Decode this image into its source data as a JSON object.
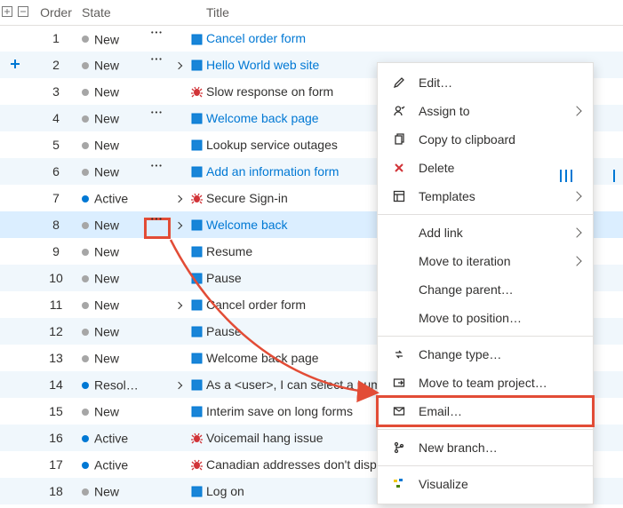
{
  "headers": {
    "order": "Order",
    "state": "State",
    "title": "Title"
  },
  "rows": [
    {
      "order": 1,
      "state": "New",
      "icon": "book",
      "title": "Cancel order form",
      "link": true,
      "actions": true,
      "expand": false
    },
    {
      "order": 2,
      "state": "New",
      "icon": "book",
      "title": "Hello World web site",
      "link": true,
      "actions": true,
      "expand": true,
      "addBtn": true
    },
    {
      "order": 3,
      "state": "New",
      "icon": "bug",
      "title": "Slow response on form",
      "link": false,
      "actions": false,
      "expand": false
    },
    {
      "order": 4,
      "state": "New",
      "icon": "book",
      "title": "Welcome back page",
      "link": true,
      "actions": true,
      "expand": false
    },
    {
      "order": 5,
      "state": "New",
      "icon": "book",
      "title": "Lookup service outages",
      "link": false,
      "actions": false,
      "expand": false
    },
    {
      "order": 6,
      "state": "New",
      "icon": "book",
      "title": "Add an information form",
      "link": true,
      "actions": true,
      "expand": false
    },
    {
      "order": 7,
      "state": "Active",
      "icon": "bug",
      "title": "Secure Sign-in",
      "link": false,
      "actions": false,
      "expand": true
    },
    {
      "order": 8,
      "state": "New",
      "icon": "book",
      "title": "Welcome back",
      "link": true,
      "actions": true,
      "expand": true,
      "actionsHighlight": true,
      "selected": true
    },
    {
      "order": 9,
      "state": "New",
      "icon": "book",
      "title": "Resume",
      "link": false,
      "actions": false,
      "expand": false
    },
    {
      "order": 10,
      "state": "New",
      "icon": "book",
      "title": "Pause",
      "link": false,
      "actions": false,
      "expand": false
    },
    {
      "order": 11,
      "state": "New",
      "icon": "book",
      "title": "Cancel order form",
      "link": false,
      "actions": false,
      "expand": true
    },
    {
      "order": 12,
      "state": "New",
      "icon": "book",
      "title": "Pause",
      "link": false,
      "actions": false,
      "expand": false
    },
    {
      "order": 13,
      "state": "New",
      "icon": "book",
      "title": "Welcome back page",
      "link": false,
      "actions": false,
      "expand": false
    },
    {
      "order": 14,
      "state": "Resol…",
      "icon": "book",
      "title": "As a <user>, I can select a numbe",
      "link": false,
      "actions": false,
      "expand": true
    },
    {
      "order": 15,
      "state": "New",
      "icon": "book",
      "title": "Interim save on long forms",
      "link": false,
      "actions": false,
      "expand": false
    },
    {
      "order": 16,
      "state": "Active",
      "icon": "bug",
      "title": "Voicemail hang issue",
      "link": false,
      "actions": false,
      "expand": false
    },
    {
      "order": 17,
      "state": "Active",
      "icon": "bug",
      "title": "Canadian addresses don't display",
      "link": false,
      "actions": false,
      "expand": false
    },
    {
      "order": 18,
      "state": "New",
      "icon": "book",
      "title": "Log on",
      "link": false,
      "actions": false,
      "expand": false
    }
  ],
  "menu": {
    "edit": "Edit…",
    "assign": "Assign to",
    "copy": "Copy to clipboard",
    "delete": "Delete",
    "templates": "Templates",
    "addlink": "Add link",
    "move_iter": "Move to iteration",
    "change_parent": "Change parent…",
    "move_pos": "Move to position…",
    "change_type": "Change type…",
    "move_team": "Move to team project…",
    "email": "Email…",
    "new_branch": "New branch…",
    "visualize": "Visualize"
  }
}
